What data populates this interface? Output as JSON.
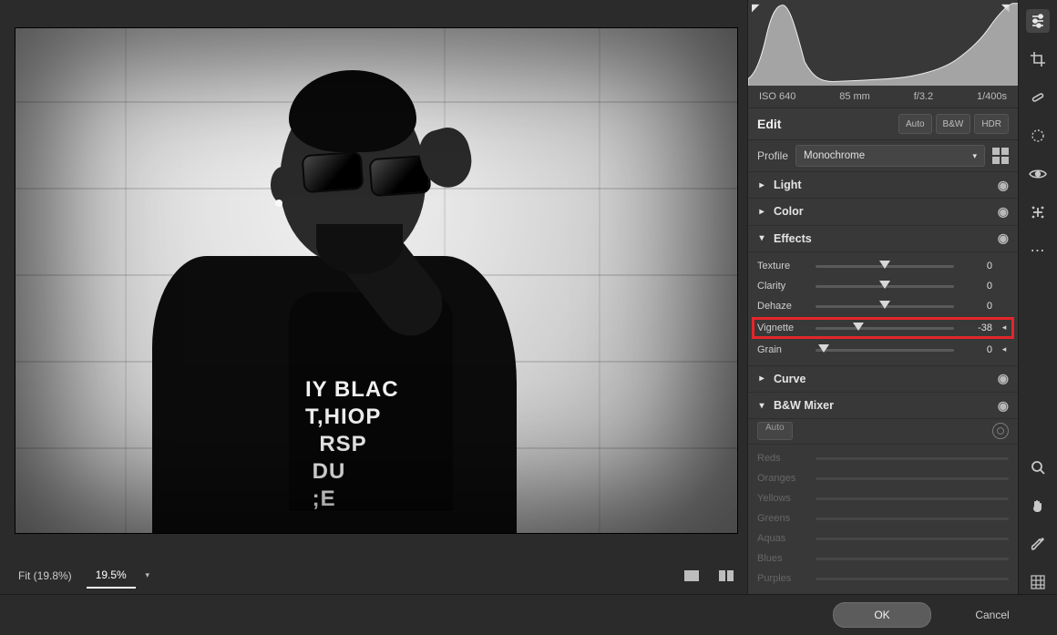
{
  "viewer": {
    "fit_label": "Fit (19.8%)",
    "zoom_label": "19.5%",
    "tshirt_text": "IY BLAC\nT,HIOP\n  RSP\n DU\n ;E"
  },
  "histogram": {
    "meta": {
      "iso": "ISO 640",
      "focal": "85 mm",
      "aperture": "f/3.2",
      "shutter": "1/400s"
    }
  },
  "edit": {
    "title": "Edit",
    "auto": "Auto",
    "bw": "B&W",
    "hdr": "HDR"
  },
  "profile": {
    "label": "Profile",
    "value": "Monochrome"
  },
  "sections": {
    "light": "Light",
    "color": "Color",
    "effects": "Effects",
    "curve": "Curve",
    "bwmixer": "B&W Mixer"
  },
  "effects": {
    "texture": {
      "label": "Texture",
      "value": "0",
      "pct": 50
    },
    "clarity": {
      "label": "Clarity",
      "value": "0",
      "pct": 50
    },
    "dehaze": {
      "label": "Dehaze",
      "value": "0",
      "pct": 50
    },
    "vignette": {
      "label": "Vignette",
      "value": "-38",
      "pct": 31
    },
    "grain": {
      "label": "Grain",
      "value": "0",
      "pct": 6
    }
  },
  "bwmixer": {
    "auto": "Auto",
    "channels": {
      "reds": {
        "label": "Reds",
        "pct": 50
      },
      "oranges": {
        "label": "Oranges",
        "pct": 50
      },
      "yellows": {
        "label": "Yellows",
        "pct": 50
      },
      "greens": {
        "label": "Greens",
        "pct": 50
      },
      "aquas": {
        "label": "Aquas",
        "pct": 50
      },
      "blues": {
        "label": "Blues",
        "pct": 50
      },
      "purples": {
        "label": "Purples",
        "pct": 50
      }
    }
  },
  "footer": {
    "ok": "OK",
    "cancel": "Cancel"
  }
}
